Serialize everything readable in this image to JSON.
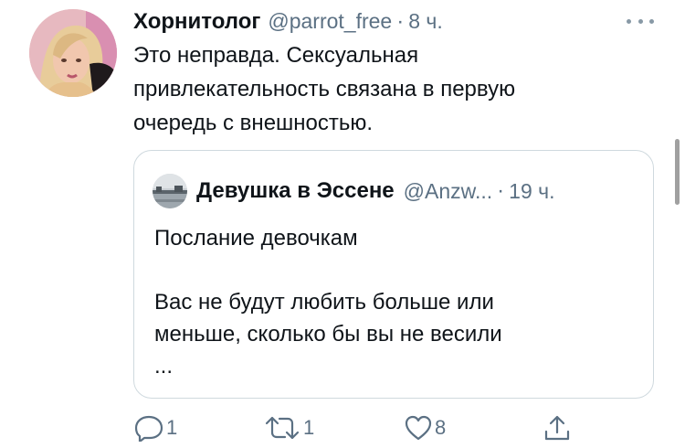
{
  "tweet": {
    "author_name": "Хорнитолог",
    "handle": "@parrot_free",
    "separator": "·",
    "time": "8 ч.",
    "text": "Это неправда. Сексуальная\nпривлекательность связана в первую\nочередь с внешностью."
  },
  "quoted_tweet": {
    "author_name": "Девушка в Эссене",
    "handle": "@Anzw...",
    "separator": "·",
    "time": "19 ч.",
    "text": "Послание девочкам\n\nВас не будут любить больше или\nменьше, сколько бы вы не весили\n..."
  },
  "actions": {
    "reply_count": "1",
    "retweet_count": "1",
    "like_count": "8"
  },
  "icons": {
    "more": "more-icon",
    "reply": "reply-icon",
    "retweet": "retweet-icon",
    "like": "heart-icon",
    "share": "share-icon"
  },
  "colors": {
    "text": "#0f1419",
    "muted": "#5b7083",
    "border": "#cfd9de"
  }
}
